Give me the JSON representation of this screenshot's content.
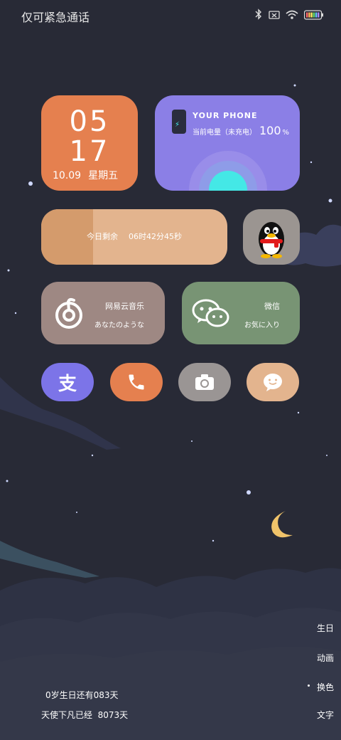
{
  "status_bar": {
    "carrier_text": "仅可紧急通话",
    "icons": [
      "bluetooth-icon",
      "no-sim-icon",
      "wifi-icon",
      "battery-icon"
    ]
  },
  "clock_widget": {
    "hour": "05",
    "minute": "17",
    "date": "10.09",
    "weekday": "星期五"
  },
  "battery_widget": {
    "title": "YOUR PHONE",
    "status": "当前电量（未充电）",
    "percent": "100",
    "percent_unit": "%",
    "level": 1.0
  },
  "countdown_widget": {
    "label": "今日剩余",
    "value": "06时42分45秒",
    "fill_fraction": 0.28
  },
  "apps": {
    "qq": {
      "icon": "qq-penguin-icon"
    },
    "netease_music": {
      "title": "网易云音乐",
      "subtitle": "あなたのような",
      "icon": "netease-music-icon"
    },
    "wechat": {
      "title": "微信",
      "subtitle": "お気に入り",
      "icon": "wechat-icon"
    }
  },
  "dock": [
    {
      "name": "alipay",
      "icon": "alipay-icon"
    },
    {
      "name": "phone",
      "icon": "phone-icon"
    },
    {
      "name": "camera",
      "icon": "camera-icon"
    },
    {
      "name": "messages",
      "icon": "message-icon"
    }
  ],
  "bottom": {
    "birthday_line": "0岁生日还有083天",
    "days_line": "天使下凡已经  8073天"
  },
  "side_menu": [
    "生日",
    "动画",
    "换色",
    "文字"
  ],
  "colors": {
    "background": "#282a36",
    "orange": "#e5804f",
    "purple": "#8b7fe6",
    "peach": "#e3b48e",
    "cyan": "#44e8e6",
    "moon": "#f0c36a"
  }
}
